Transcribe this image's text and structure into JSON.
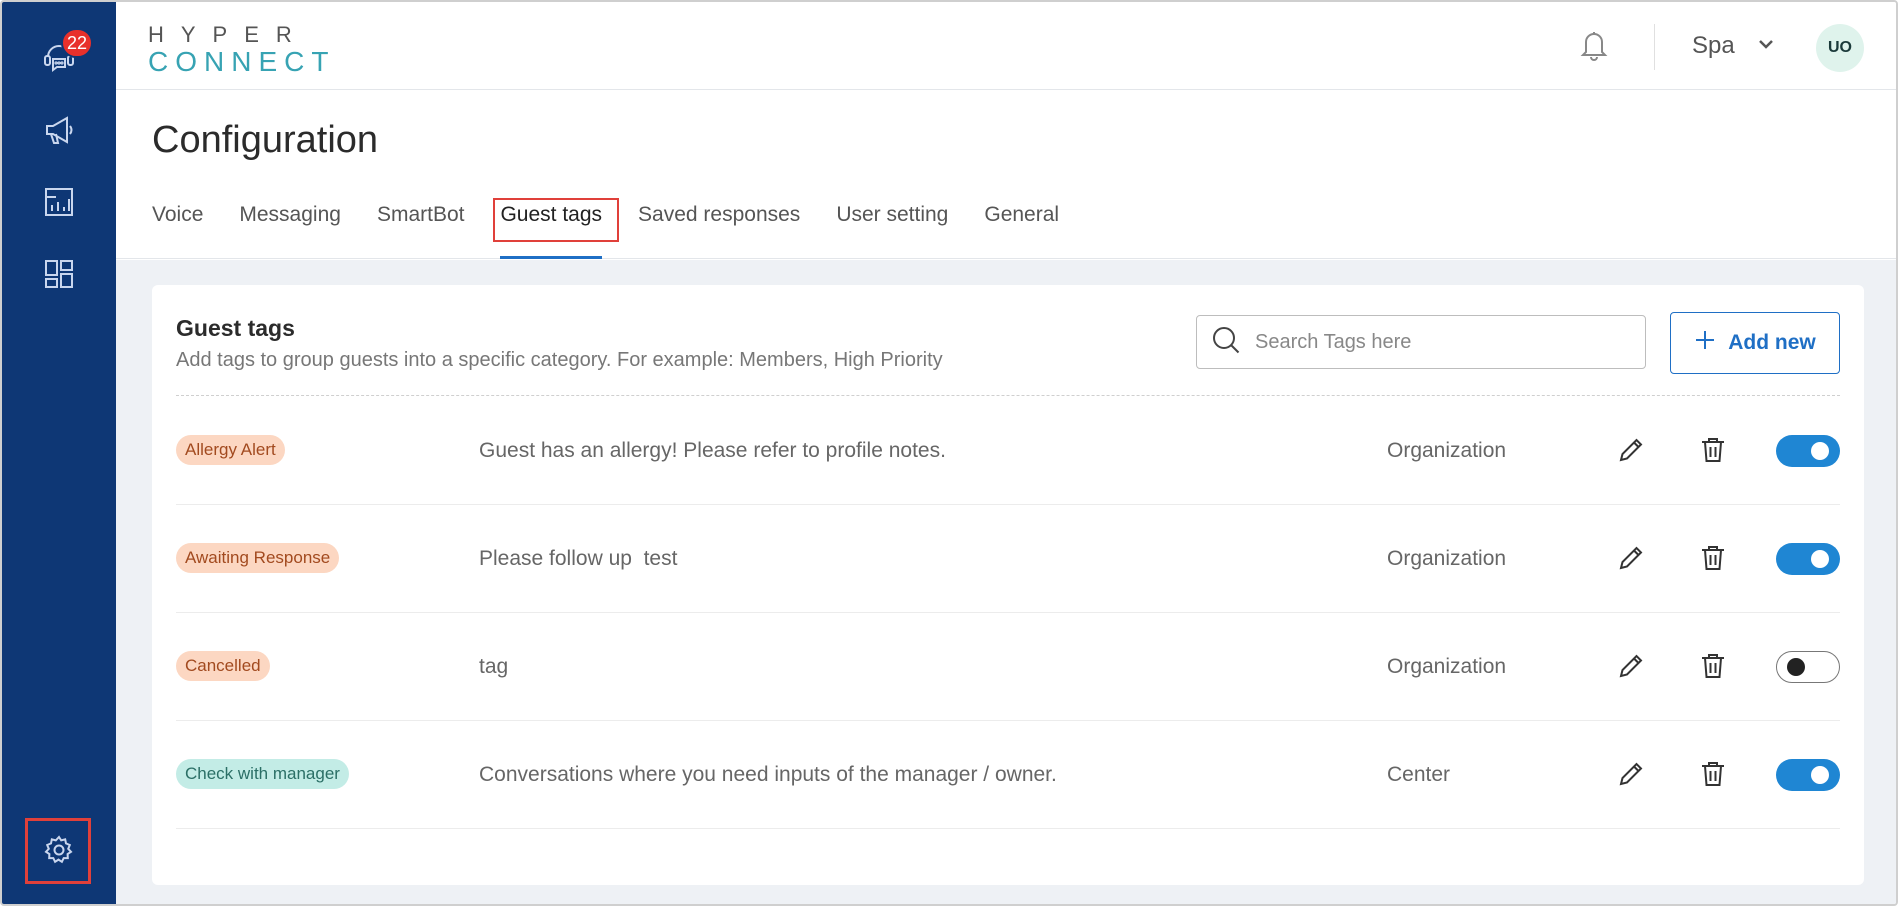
{
  "sidebar": {
    "badge_count": "22",
    "items": [
      {
        "icon": "support-agent-icon"
      },
      {
        "icon": "megaphone-icon"
      },
      {
        "icon": "report-icon"
      },
      {
        "icon": "dashboard-icon"
      }
    ],
    "settings_icon": "gear-icon"
  },
  "header": {
    "logo_top": "HYPER",
    "logo_bottom": "CONNECT",
    "property": "Spa",
    "avatar_initials": "UO"
  },
  "page": {
    "title": "Configuration",
    "tabs": [
      {
        "label": "Voice"
      },
      {
        "label": "Messaging"
      },
      {
        "label": "SmartBot"
      },
      {
        "label": "Guest tags",
        "active": true
      },
      {
        "label": "Saved responses"
      },
      {
        "label": "User setting"
      },
      {
        "label": "General"
      }
    ]
  },
  "guest_tags": {
    "title": "Guest tags",
    "subtitle": "Add tags to group guests into a specific category. For example: Members, High Priority",
    "search_placeholder": "Search Tags here",
    "add_label": "Add new",
    "rows": [
      {
        "tag": "Allergy Alert",
        "tag_bg": "#fcd7c2",
        "tag_color": "#a24a1f",
        "description": "Guest has an allergy! Please refer to profile notes.",
        "scope": "Organization",
        "enabled": true
      },
      {
        "tag": "Awaiting Response",
        "tag_bg": "#fcd7c2",
        "tag_color": "#a24a1f",
        "description": "Please follow up  test",
        "scope": "Organization",
        "enabled": true
      },
      {
        "tag": "Cancelled",
        "tag_bg": "#fcd7c2",
        "tag_color": "#a24a1f",
        "description": "tag",
        "scope": "Organization",
        "enabled": false
      },
      {
        "tag": "Check with manager",
        "tag_bg": "#c3ece6",
        "tag_color": "#2b6f66",
        "description": "Conversations where you need inputs of the manager / owner.",
        "scope": "Center",
        "enabled": true
      }
    ]
  },
  "colors": {
    "sidebar": "#0e3775",
    "accent": "#1f6fc5",
    "toggle_on": "#1f86d3",
    "highlight": "#e0403a"
  }
}
